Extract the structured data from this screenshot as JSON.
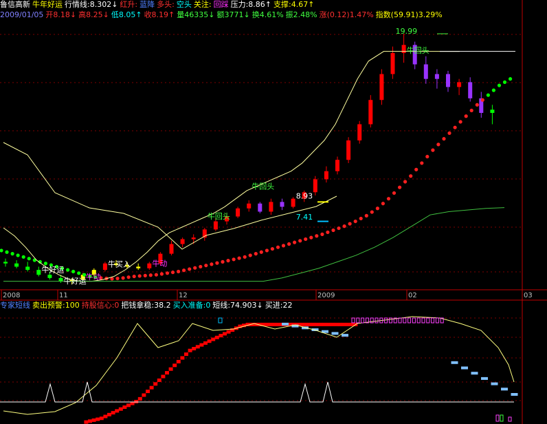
{
  "header1": [
    {
      "text": "鲁信高新",
      "color": "#ffffff"
    },
    {
      "text": "牛年好运",
      "color": "#ffff00"
    },
    {
      "text": "行情线:8.302↓",
      "color": "#ffffff"
    },
    {
      "text": "红升:",
      "color": "#ff3030"
    },
    {
      "text": "蓝降",
      "color": "#5080ff"
    },
    {
      "text": "多头:",
      "color": "#ff3030"
    },
    {
      "text": "空头",
      "color": "#00ffff"
    },
    {
      "text": "关注:",
      "color": "#ffff00"
    },
    {
      "text": "回踩",
      "color": "#ff30ff"
    },
    {
      "text": "压力:8.86↑",
      "color": "#ffffff"
    },
    {
      "text": "支撑:4.67↑",
      "color": "#ffff00"
    }
  ],
  "header2": [
    {
      "text": "2009/01/05",
      "color": "#8080ff"
    },
    {
      "text": "开8.18↓",
      "color": "#ff3030"
    },
    {
      "text": "高8.25↓",
      "color": "#ff3030"
    },
    {
      "text": "低8.05↑",
      "color": "#00ffff"
    },
    {
      "text": "收8.19↑",
      "color": "#ff3030"
    },
    {
      "text": "量46335↓",
      "color": "#40ff40"
    },
    {
      "text": "额3771↓",
      "color": "#40ff40"
    },
    {
      "text": "换4.61%",
      "color": "#40ff40"
    },
    {
      "text": "振2.48%",
      "color": "#40ff40"
    },
    {
      "text": "涨(0.12)1.47%",
      "color": "#ff3030"
    },
    {
      "text": "指数(59.91)3.29%",
      "color": "#ffff00"
    }
  ],
  "header3": [
    {
      "text": "专家短线",
      "color": "#5080ff"
    },
    {
      "text": "卖出预警:100",
      "color": "#ffff00"
    },
    {
      "text": "持股信心:0",
      "color": "#ff3030"
    },
    {
      "text": "把钱拿稳:38.2",
      "color": "#ffffff"
    },
    {
      "text": "买入准备:0",
      "color": "#00ffff"
    },
    {
      "text": "短线:74.903↓",
      "color": "#ffffff"
    },
    {
      "text": "买进:22",
      "color": "#ffffff"
    }
  ],
  "colors": {
    "background": "#000000",
    "up": "#ff0000",
    "down_purple": "#9933ff",
    "green_candle": "#00ff00",
    "yellow_candle": "#ffff00",
    "grid": "#800000",
    "axis": "#c00000",
    "short_line": "#ffff80",
    "blue_bar": "#80c0ff"
  },
  "chart_data": [
    {
      "type": "candlestick",
      "ylim": [
        4.3,
        20.8
      ],
      "x_ticks": [
        "2008",
        "11",
        "12",
        "2009",
        "02",
        "03"
      ],
      "annotations": [
        {
          "text": "牛回头",
          "color": "#40ff40",
          "price": 18.8,
          "index": 37
        },
        {
          "text": "19.99",
          "color": "#40ff40",
          "price": 19.99,
          "index": 36
        },
        {
          "text": "牛回头",
          "color": "#40ff40",
          "price": 10.4,
          "index": 23
        },
        {
          "text": "牛回头",
          "color": "#40ff40",
          "price": 8.55,
          "index": 19
        },
        {
          "text": "8.93",
          "color": "#ffffff",
          "price": 9.8,
          "index": 27
        },
        {
          "text": "7.41",
          "color": "#00ffff",
          "price": 8.5,
          "index": 27
        },
        {
          "text": "牛好运",
          "color": "#ffffff",
          "price": 5.25,
          "index": 4
        },
        {
          "text": "牛好运",
          "color": "#ffffff",
          "price": 4.55,
          "index": 6
        },
        {
          "text": "牛买入",
          "color": "#ffffff",
          "price": 5.6,
          "index": 10
        },
        {
          "text": "牛动",
          "color": "#ff30ff",
          "price": 5.65,
          "index": 14
        },
        {
          "text": "牛动",
          "color": "#ff30ff",
          "price": 4.8,
          "index": 8
        }
      ],
      "candles": [
        {
          "o": 5.9,
          "h": 6.1,
          "l": 5.6,
          "c": 5.8,
          "color": "#00ff00"
        },
        {
          "o": 5.8,
          "h": 6.0,
          "l": 5.5,
          "c": 5.6,
          "color": "#00ff00"
        },
        {
          "o": 5.6,
          "h": 5.9,
          "l": 5.3,
          "c": 5.4,
          "color": "#00ff00"
        },
        {
          "o": 5.4,
          "h": 5.6,
          "l": 5.0,
          "c": 5.1,
          "color": "#00ff00"
        },
        {
          "o": 5.1,
          "h": 5.3,
          "l": 4.8,
          "c": 4.9,
          "color": "#00ff00"
        },
        {
          "o": 4.9,
          "h": 5.1,
          "l": 4.6,
          "c": 4.7,
          "color": "#00ff00"
        },
        {
          "o": 4.7,
          "h": 4.9,
          "l": 4.5,
          "c": 4.8,
          "color": "#ffff00"
        },
        {
          "o": 4.8,
          "h": 5.2,
          "l": 4.7,
          "c": 5.1,
          "color": "#ffff00"
        },
        {
          "o": 5.1,
          "h": 5.5,
          "l": 5.0,
          "c": 5.4,
          "color": "#ffff00"
        },
        {
          "o": 5.4,
          "h": 5.9,
          "l": 5.3,
          "c": 5.8,
          "color": "#ff0000"
        },
        {
          "o": 5.8,
          "h": 6.0,
          "l": 5.6,
          "c": 5.7,
          "color": "#ffff00"
        },
        {
          "o": 5.7,
          "h": 5.9,
          "l": 5.5,
          "c": 5.6,
          "color": "#ffff00"
        },
        {
          "o": 5.6,
          "h": 5.8,
          "l": 5.4,
          "c": 5.5,
          "color": "#ffff00"
        },
        {
          "o": 5.5,
          "h": 5.9,
          "l": 5.4,
          "c": 5.8,
          "color": "#ff0000"
        },
        {
          "o": 5.8,
          "h": 6.5,
          "l": 5.7,
          "c": 6.4,
          "color": "#ff0000"
        },
        {
          "o": 6.4,
          "h": 7.2,
          "l": 6.3,
          "c": 7.0,
          "color": "#ff0000"
        },
        {
          "o": 7.0,
          "h": 7.4,
          "l": 6.8,
          "c": 7.3,
          "color": "#ff0000"
        },
        {
          "o": 7.3,
          "h": 7.6,
          "l": 7.0,
          "c": 7.4,
          "color": "#ff0000"
        },
        {
          "o": 7.4,
          "h": 8.0,
          "l": 7.2,
          "c": 7.9,
          "color": "#ff0000"
        },
        {
          "o": 7.9,
          "h": 8.6,
          "l": 7.8,
          "c": 8.4,
          "color": "#ff0000"
        },
        {
          "o": 8.4,
          "h": 8.9,
          "l": 8.2,
          "c": 8.7,
          "color": "#ff0000"
        },
        {
          "o": 8.7,
          "h": 9.3,
          "l": 8.6,
          "c": 9.2,
          "color": "#ff0000"
        },
        {
          "o": 9.2,
          "h": 9.7,
          "l": 9.0,
          "c": 9.5,
          "color": "#ff0000"
        },
        {
          "o": 9.5,
          "h": 9.6,
          "l": 8.9,
          "c": 9.0,
          "color": "#9933ff"
        },
        {
          "o": 9.0,
          "h": 9.8,
          "l": 8.8,
          "c": 9.6,
          "color": "#ff0000"
        },
        {
          "o": 9.6,
          "h": 9.8,
          "l": 9.1,
          "c": 9.3,
          "color": "#9933ff"
        },
        {
          "o": 9.3,
          "h": 9.9,
          "l": 9.2,
          "c": 9.8,
          "color": "#ff0000"
        },
        {
          "o": 9.8,
          "h": 10.3,
          "l": 9.6,
          "c": 10.2,
          "color": "#ff0000"
        },
        {
          "o": 10.2,
          "h": 11.2,
          "l": 10.0,
          "c": 11.0,
          "color": "#ff0000"
        },
        {
          "o": 11.0,
          "h": 11.8,
          "l": 10.8,
          "c": 11.5,
          "color": "#ff0000"
        },
        {
          "o": 11.5,
          "h": 12.4,
          "l": 11.3,
          "c": 12.2,
          "color": "#ff0000"
        },
        {
          "o": 12.2,
          "h": 13.6,
          "l": 12.0,
          "c": 13.4,
          "color": "#ff0000"
        },
        {
          "o": 13.4,
          "h": 14.6,
          "l": 13.2,
          "c": 14.4,
          "color": "#ff0000"
        },
        {
          "o": 14.4,
          "h": 16.2,
          "l": 14.2,
          "c": 15.9,
          "color": "#ff0000"
        },
        {
          "o": 15.9,
          "h": 17.8,
          "l": 15.6,
          "c": 17.5,
          "color": "#ff0000"
        },
        {
          "o": 17.5,
          "h": 19.2,
          "l": 17.2,
          "c": 18.8,
          "color": "#ff0000"
        },
        {
          "o": 18.8,
          "h": 19.99,
          "l": 18.2,
          "c": 19.3,
          "color": "#ff0000"
        },
        {
          "o": 19.3,
          "h": 19.5,
          "l": 17.8,
          "c": 18.1,
          "color": "#9933ff"
        },
        {
          "o": 18.1,
          "h": 18.6,
          "l": 16.9,
          "c": 17.2,
          "color": "#9933ff"
        },
        {
          "o": 17.2,
          "h": 17.8,
          "l": 16.6,
          "c": 17.5,
          "color": "#9933ff"
        },
        {
          "o": 17.5,
          "h": 17.7,
          "l": 16.4,
          "c": 16.7,
          "color": "#9933ff"
        },
        {
          "o": 16.7,
          "h": 17.2,
          "l": 16.2,
          "c": 17.0,
          "color": "#ff0000"
        },
        {
          "o": 17.0,
          "h": 17.3,
          "l": 15.8,
          "c": 16.0,
          "color": "#9933ff"
        },
        {
          "o": 16.0,
          "h": 16.4,
          "l": 14.8,
          "c": 15.1,
          "color": "#9933ff"
        },
        {
          "o": 15.1,
          "h": 15.6,
          "l": 14.4,
          "c": 15.3,
          "color": "#00ff00"
        }
      ],
      "sar": [
        6.6,
        6.4,
        6.2,
        6.0,
        5.8,
        5.6,
        5.4,
        5.2,
        5.0,
        4.9,
        4.85,
        4.9,
        5.0,
        5.05,
        5.1,
        5.2,
        5.3,
        5.45,
        5.6,
        5.75,
        5.9,
        6.05,
        6.2,
        6.4,
        6.6,
        6.8,
        7.0,
        7.2,
        7.4,
        7.6,
        7.85,
        8.1,
        8.4,
        8.75,
        9.2,
        9.8,
        10.5,
        11.2,
        12.0,
        12.8,
        13.5,
        14.2,
        14.9,
        15.6,
        16.2,
        16.8,
        17.2
      ],
      "short_line": [
        8.0,
        7.5,
        6.8,
        6.0,
        5.5,
        5.1,
        4.8,
        4.7,
        4.7,
        4.8,
        5.0,
        5.4,
        5.9,
        6.5,
        7.2,
        7.7,
        8.0,
        8.3,
        8.6,
        8.9,
        9.3,
        9.8,
        10.3,
        10.6,
        10.9,
        11.2,
        11.5,
        12.0,
        12.7,
        13.4,
        14.4,
        15.8,
        17.2,
        18.3,
        18.9,
        18.9,
        18.9,
        18.9,
        18.9,
        18.9
      ],
      "lower_line": [
        4.7,
        4.7,
        4.7,
        4.7,
        4.7,
        4.7,
        4.7,
        4.7,
        4.7,
        4.7,
        4.7,
        4.7,
        4.7,
        4.7,
        4.7,
        4.9,
        5.2,
        5.5,
        5.9,
        6.3,
        6.8,
        7.4,
        8.1,
        8.8,
        9.0,
        9.1,
        9.2,
        9.25
      ]
    },
    {
      "type": "bar",
      "red_steps": [
        0,
        0,
        0,
        0,
        1,
        2,
        3,
        4,
        5,
        7,
        9,
        11,
        13,
        15,
        17,
        19,
        21,
        23,
        26,
        30,
        34,
        38,
        42,
        46,
        50,
        54,
        58,
        62,
        66,
        70,
        74,
        78,
        80,
        82,
        84,
        86,
        88,
        90,
        92,
        94,
        96,
        98,
        100,
        102,
        104,
        105,
        106,
        106,
        106,
        106,
        106,
        106,
        106,
        106,
        106,
        106,
        106,
        106,
        106,
        106,
        106,
        106,
        106,
        106,
        106,
        106,
        106,
        106,
        106,
        106,
        106,
        106,
        106,
        106,
        106
      ],
      "blue_steps": [
        106,
        104,
        102,
        100,
        98,
        96,
        94,
        92,
        90,
        88,
        86,
        84,
        82,
        80,
        78,
        76,
        74,
        72,
        70,
        68,
        66,
        64,
        62,
        60
      ]
    }
  ]
}
